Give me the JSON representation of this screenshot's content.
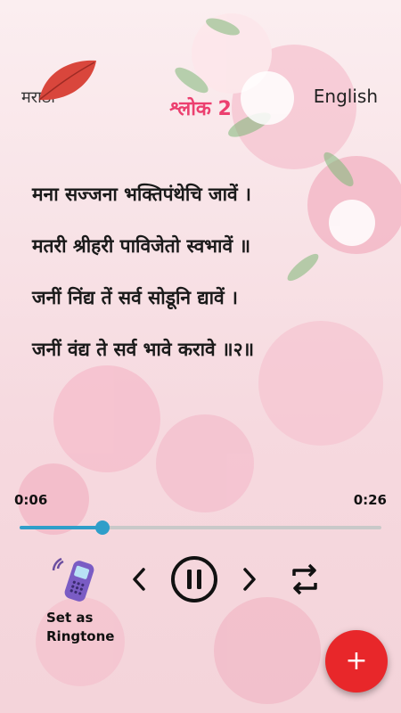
{
  "header": {
    "language_left": "मराठी",
    "title": "श्लोक 2",
    "language_right": "English"
  },
  "verse": {
    "lines": [
      "मना सज्जना भक्तिपंथेचि जावें ।",
      "मतरी श्रीहरी पाविजेतो स्वभावें ॥",
      "जनीं निंद्य तें सर्व सोडूनि द्यावें ।",
      "जनीं वंद्य ते सर्व भावे करावे ॥२॥"
    ]
  },
  "player": {
    "current_time": "0:06",
    "total_time": "0:26",
    "progress": 0.23
  },
  "ringtone": {
    "label_line1": "Set as",
    "label_line2": "Ringtone"
  },
  "icons": {
    "leaf": "leaf-icon",
    "ringtone": "phone-ringing-icon",
    "prev": "chevron-left-icon",
    "play": "pause-icon",
    "next": "chevron-right-icon",
    "repeat": "repeat-icon",
    "fab": "plus-icon"
  },
  "fab": {
    "label": "+"
  },
  "colors": {
    "title": "#ec3f6f",
    "accent": "#2f9ec9",
    "fab": "#e8272a"
  }
}
